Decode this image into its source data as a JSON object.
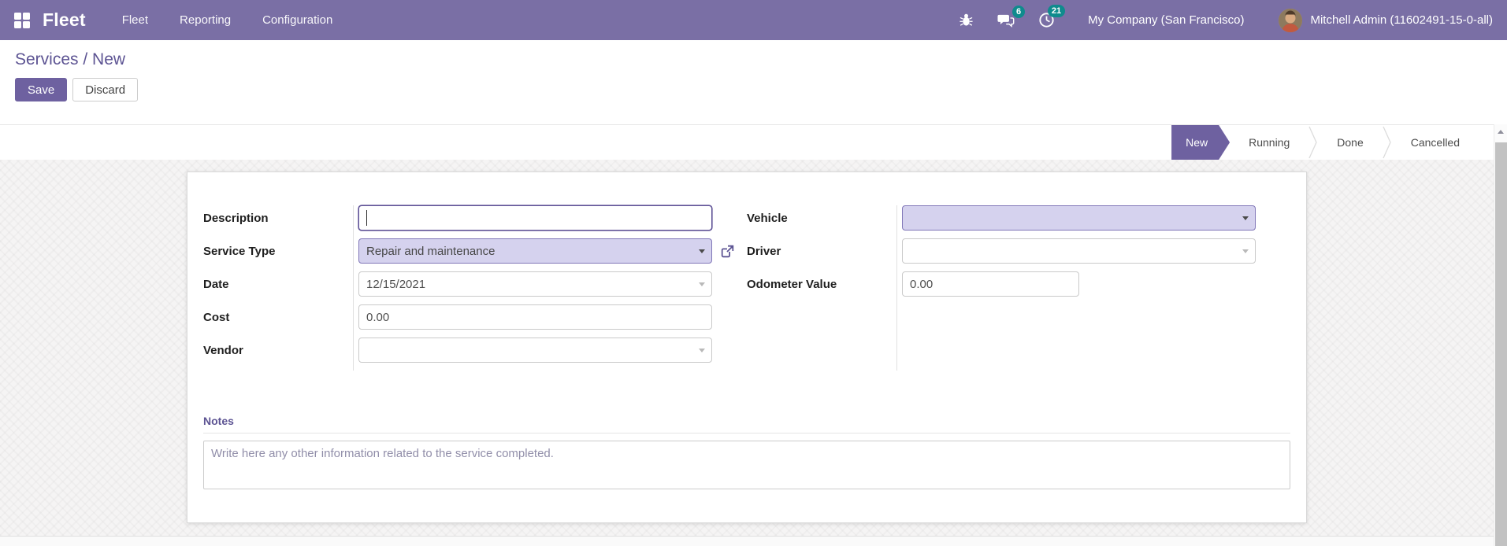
{
  "navbar": {
    "brand": "Fleet",
    "menus": [
      {
        "label": "Fleet"
      },
      {
        "label": "Reporting"
      },
      {
        "label": "Configuration"
      }
    ],
    "messages_count": "6",
    "activities_count": "21",
    "company": "My Company (San Francisco)",
    "user": "Mitchell Admin (11602491-15-0-all)"
  },
  "breadcrumb": {
    "parent": "Services",
    "separator": " / ",
    "current": "New"
  },
  "buttons": {
    "save": "Save",
    "discard": "Discard"
  },
  "statusbar": {
    "stages": [
      {
        "label": "New",
        "active": true
      },
      {
        "label": "Running",
        "active": false
      },
      {
        "label": "Done",
        "active": false
      },
      {
        "label": "Cancelled",
        "active": false
      }
    ]
  },
  "form": {
    "fields": {
      "description": {
        "label": "Description",
        "value": ""
      },
      "service_type": {
        "label": "Service Type",
        "value": "Repair and maintenance"
      },
      "date": {
        "label": "Date",
        "value": "12/15/2021"
      },
      "cost": {
        "label": "Cost",
        "value": "0.00"
      },
      "vendor": {
        "label": "Vendor",
        "value": ""
      },
      "vehicle": {
        "label": "Vehicle",
        "value": ""
      },
      "driver": {
        "label": "Driver",
        "value": ""
      },
      "odometer": {
        "label": "Odometer Value",
        "value": "0.00"
      }
    },
    "notes": {
      "title": "Notes",
      "placeholder": "Write here any other information related to the service completed."
    }
  },
  "colors": {
    "navbar_bg": "#7A6FA5",
    "accent": "#6E61A0",
    "badge": "#0F8B8D",
    "required_field_bg": "#D5D2EE",
    "breadcrumb_text": "#5D5493"
  }
}
